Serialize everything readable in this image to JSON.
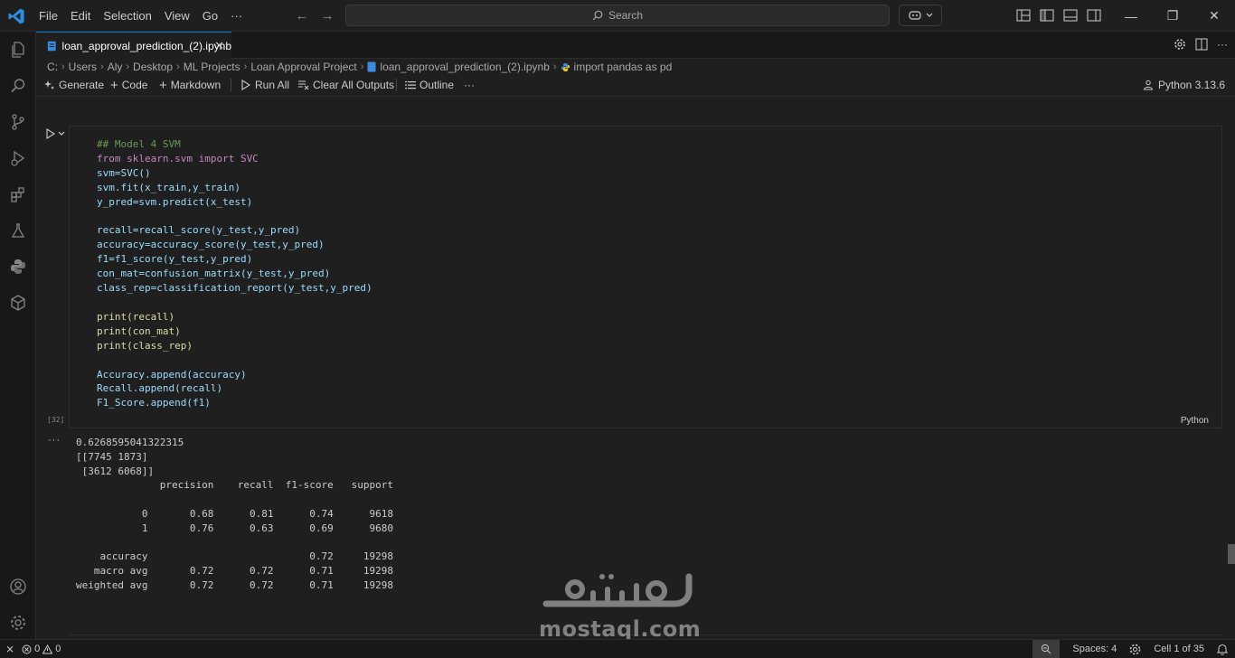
{
  "menu": [
    "File",
    "Edit",
    "Selection",
    "View",
    "Go",
    "···"
  ],
  "search": {
    "placeholder": "Search"
  },
  "tab": {
    "title": "loan_approval_prediction_(2).ipynb"
  },
  "breadcrumb": [
    "C:",
    "Users",
    "Aly",
    "Desktop",
    "ML Projects",
    "Loan Approval Project",
    "loan_approval_prediction_(2).ipynb",
    "import pandas as pd"
  ],
  "toolbar": {
    "generate": "Generate",
    "code": "Code",
    "markdown": "Markdown",
    "run_all": "Run All",
    "clear_outputs": "Clear All Outputs",
    "outline": "Outline",
    "more": "···",
    "kernel": "Python 3.13.6"
  },
  "cell": {
    "execution_count": "[32]",
    "language": "Python",
    "code_lines": [
      "## Model 4 SVM",
      "from sklearn.svm import SVC",
      "svm=SVC()",
      "svm.fit(x_train,y_train)",
      "y_pred=svm.predict(x_test)",
      "",
      "recall=recall_score(y_test,y_pred)",
      "accuracy=accuracy_score(y_test,y_pred)",
      "f1=f1_score(y_test,y_pred)",
      "con_mat=confusion_matrix(y_test,y_pred)",
      "class_rep=classification_report(y_test,y_pred)",
      "",
      "print(recall)",
      "print(con_mat)",
      "print(class_rep)",
      "",
      "Accuracy.append(accuracy)",
      "Recall.append(recall)",
      "F1_Score.append(f1)"
    ]
  },
  "output": {
    "lines": [
      "0.6268595041322315",
      "[[7745 1873]",
      " [3612 6068]]",
      "              precision    recall  f1-score   support",
      "",
      "           0       0.68      0.81      0.74      9618",
      "           1       0.76      0.63      0.69      9680",
      "",
      "    accuracy                           0.72     19298",
      "   macro avg       0.72      0.72      0.71     19298",
      "weighted avg       0.72      0.72      0.71     19298"
    ]
  },
  "statusbar": {
    "errors": "0",
    "warnings": "0",
    "spaces": "Spaces: 4",
    "cell_position": "Cell 1 of 35"
  },
  "watermark": {
    "text": "mostaql.com",
    "arabic": "مستقل"
  },
  "colors": {
    "accent": "#0078d4",
    "background": "#1f1f1f",
    "sidebar": "#181818"
  }
}
